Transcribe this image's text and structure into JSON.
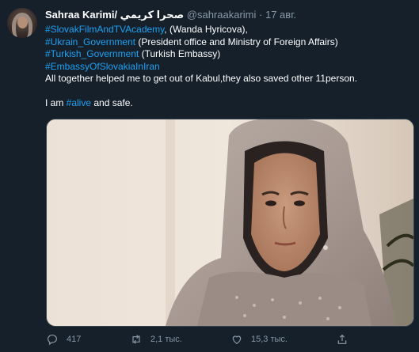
{
  "tweet": {
    "author_name": "Sahraa Karimi/ صحرا كريمي",
    "handle": "@sahraakarimi",
    "separator": "·",
    "date": "17 авг.",
    "lines": [
      {
        "tag": "#SlovakFilmAndTVAcademy",
        "text": ", (Wanda Hyricova),"
      },
      {
        "tag": " #Ukrain_Government",
        "text": " (President office and Ministry of Foreign Affairs)"
      },
      {
        "tag": "#Turkish_Government",
        "text": " (Turkish Embassy)"
      },
      {
        "tag": "#EmbassyOfSlovakiaInIran",
        "text": ""
      }
    ],
    "sentence": "All together helped me to get out of Kabul,they also saved other 11person.",
    "closing_prefix": "I am ",
    "closing_tag": "#alive",
    "closing_suffix": " and safe."
  },
  "actions": {
    "reply_count": "417",
    "retweet_count": "2,1 тыс.",
    "like_count": "15,3 тыс."
  },
  "icons": {
    "reply": "reply-icon",
    "retweet": "retweet-icon",
    "like": "like-heart-icon",
    "share": "share-icon"
  },
  "colors": {
    "background": "#15202b",
    "link": "#1da1f2",
    "secondary_text": "#8899a6",
    "primary_text": "#ffffff"
  }
}
